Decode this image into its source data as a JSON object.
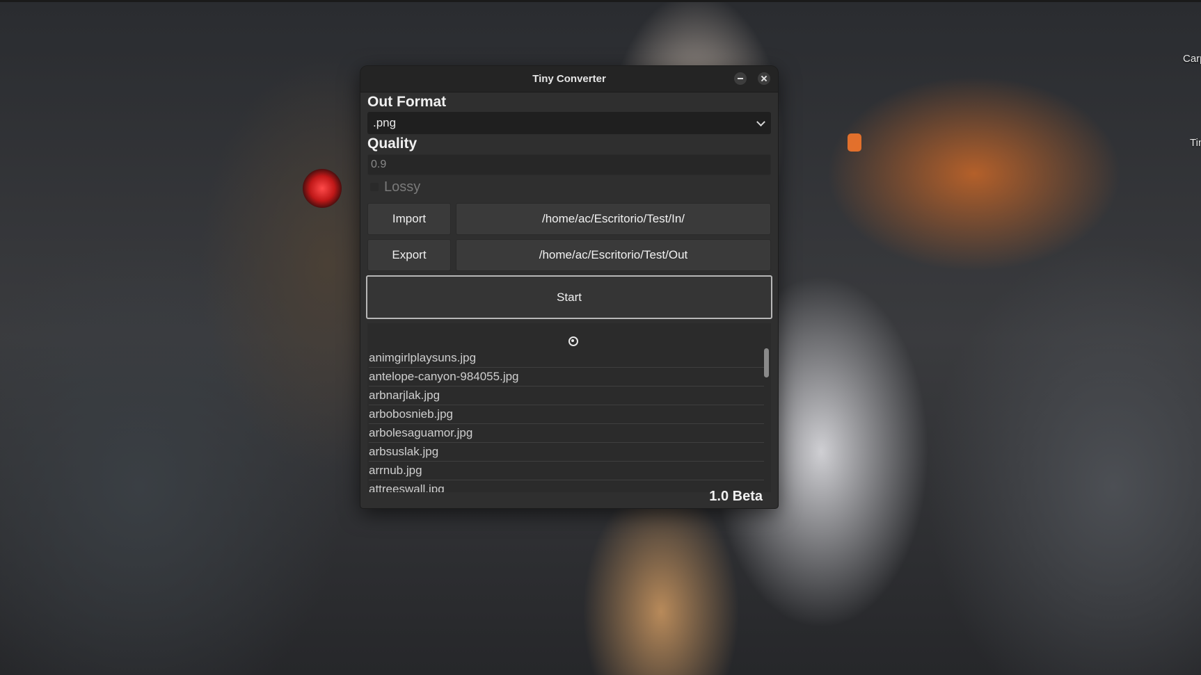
{
  "desktop": {
    "labels": [
      "Carp",
      "Tin"
    ]
  },
  "window": {
    "title": "Tiny Converter"
  },
  "format": {
    "label": "Out Format",
    "selected": ".png"
  },
  "quality": {
    "label": "Quality",
    "value": "0.9"
  },
  "lossy": {
    "label": "Lossy",
    "checked": false
  },
  "import": {
    "button": "Import",
    "path": "/home/ac/Escritorio/Test/In/"
  },
  "export": {
    "button": "Export",
    "path": "/home/ac/Escritorio/Test/Out"
  },
  "start": {
    "label": "Start"
  },
  "files": [
    "animgirlplaysuns.jpg",
    "antelope-canyon-984055.jpg",
    "arbnarjlak.jpg",
    "arbobosnieb.jpg",
    "arbolesaguamor.jpg",
    "arbsuslak.jpg",
    "arrnub.jpg",
    "attreeswall.jpg"
  ],
  "version": "1.0 Beta"
}
